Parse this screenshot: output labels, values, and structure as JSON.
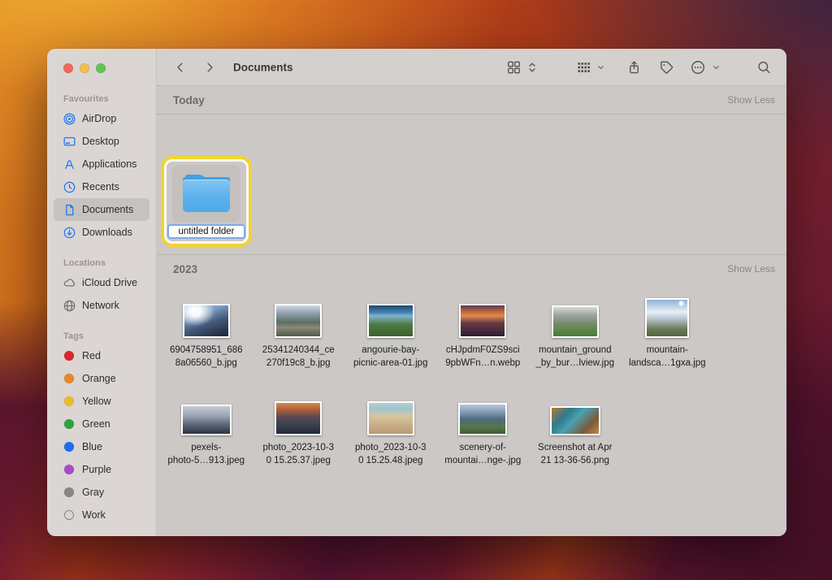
{
  "colors": {
    "traffic_close": "#ee6a5e",
    "traffic_min": "#f5bd4f",
    "traffic_zoom": "#61c455",
    "highlight_ring": "#f3d32f",
    "folder_blue": "#57aeea",
    "sidebar_icon_blue": "#2276f0"
  },
  "toolbar": {
    "title": "Documents"
  },
  "sidebar": {
    "sections": [
      {
        "label": "Favourites",
        "items": [
          {
            "label": "AirDrop"
          },
          {
            "label": "Desktop"
          },
          {
            "label": "Applications"
          },
          {
            "label": "Recents"
          },
          {
            "label": "Documents"
          },
          {
            "label": "Downloads"
          }
        ]
      },
      {
        "label": "Locations",
        "items": [
          {
            "label": "iCloud Drive"
          },
          {
            "label": "Network"
          }
        ]
      },
      {
        "label": "Tags",
        "items": [
          {
            "label": "Red",
            "color": "#d8262c"
          },
          {
            "label": "Orange",
            "color": "#e8872c"
          },
          {
            "label": "Yellow",
            "color": "#eabd2e"
          },
          {
            "label": "Green",
            "color": "#2fa43c"
          },
          {
            "label": "Blue",
            "color": "#1e6ef0"
          },
          {
            "label": "Purple",
            "color": "#a64bc9"
          },
          {
            "label": "Gray",
            "color": "#8a8683"
          },
          {
            "label": "Work",
            "color": "transparent"
          }
        ]
      }
    ],
    "selected_item": "Documents"
  },
  "main": {
    "groups": [
      {
        "title": "Today",
        "action_label": "Show Less",
        "folder": {
          "name": "untitled folder",
          "type": "folder",
          "state": "renaming"
        }
      },
      {
        "title": "2023",
        "action_label": "Show Less",
        "files": [
          {
            "name_line1": "6904758951_686",
            "name_line2": "8a06560_b.jpg"
          },
          {
            "name_line1": "25341240344_ce",
            "name_line2": "270f19c8_b.jpg"
          },
          {
            "name_line1": "angourie-bay-",
            "name_line2": "picnic-area-01.jpg"
          },
          {
            "name_line1": "cHJpdmF0ZS9sci",
            "name_line2": "9pbWFn…n.webp"
          },
          {
            "name_line1": "mountain_ground",
            "name_line2": "_by_bur…lview.jpg"
          },
          {
            "name_line1": "mountain-",
            "name_line2": "landsca…1gxa.jpg"
          },
          {
            "name_line1": "pexels-",
            "name_line2": "photo-5…913.jpeg"
          },
          {
            "name_line1": "photo_2023-10-3",
            "name_line2": "0 15.25.37.jpeg"
          },
          {
            "name_line1": "photo_2023-10-3",
            "name_line2": "0 15.25.48.jpeg"
          },
          {
            "name_line1": "scenery-of-",
            "name_line2": "mountai…nge-.jpg"
          },
          {
            "name_line1": "Screenshot at Apr",
            "name_line2": "21 13-36-56.png"
          }
        ]
      }
    ]
  }
}
